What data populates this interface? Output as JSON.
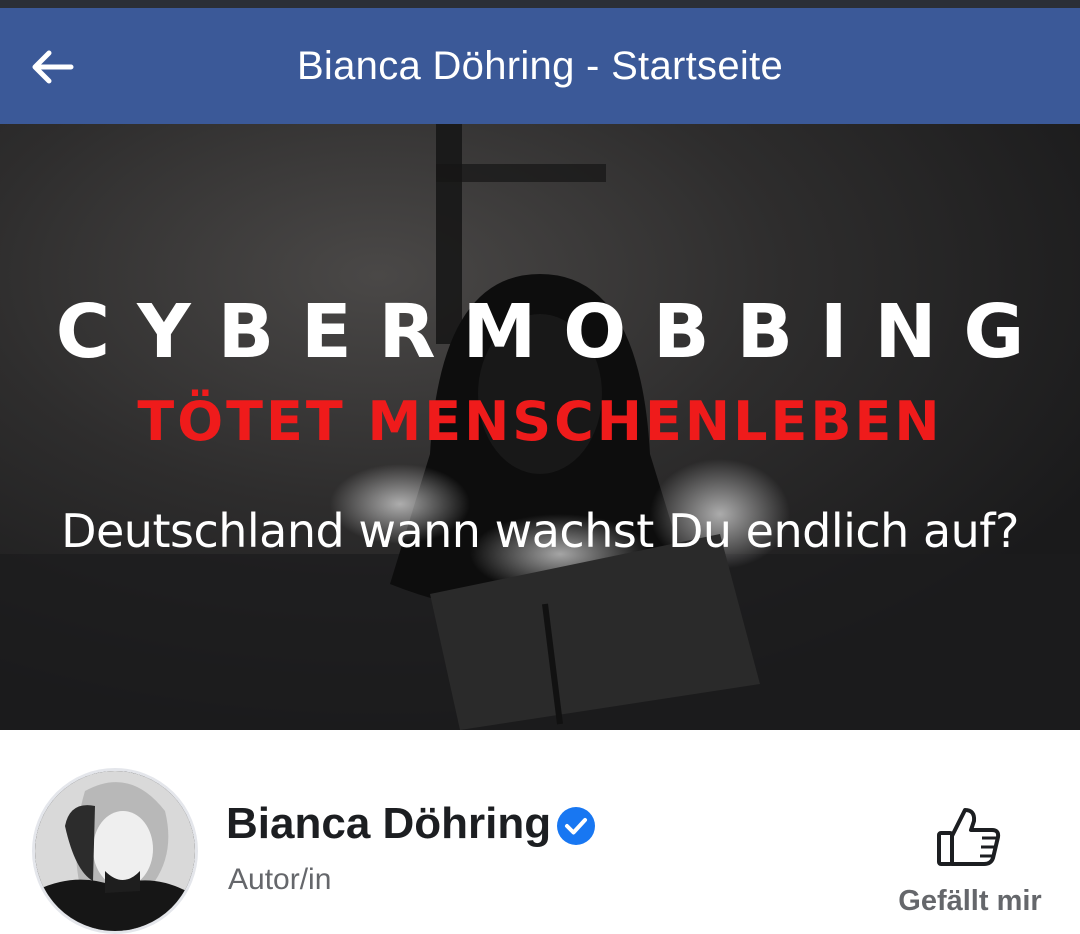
{
  "header": {
    "title": "Bianca Döhring - Startseite",
    "back_icon": "arrow-left-icon",
    "background_color": "#3b5998"
  },
  "cover": {
    "headline": "CYBERMOBBING",
    "subheadline": "TÖTET MENSCHENLEBEN",
    "question": "Deutschland wann wachst Du endlich auf?",
    "headline_color": "#ffffff",
    "subheadline_color": "#ef1b1b"
  },
  "profile": {
    "name": "Bianca Döhring",
    "verified_icon": "verified-badge-icon",
    "verified_color": "#1877f2",
    "category": "Autor/in",
    "like_icon": "thumbs-up-icon",
    "like_label": "Gefällt mir"
  }
}
